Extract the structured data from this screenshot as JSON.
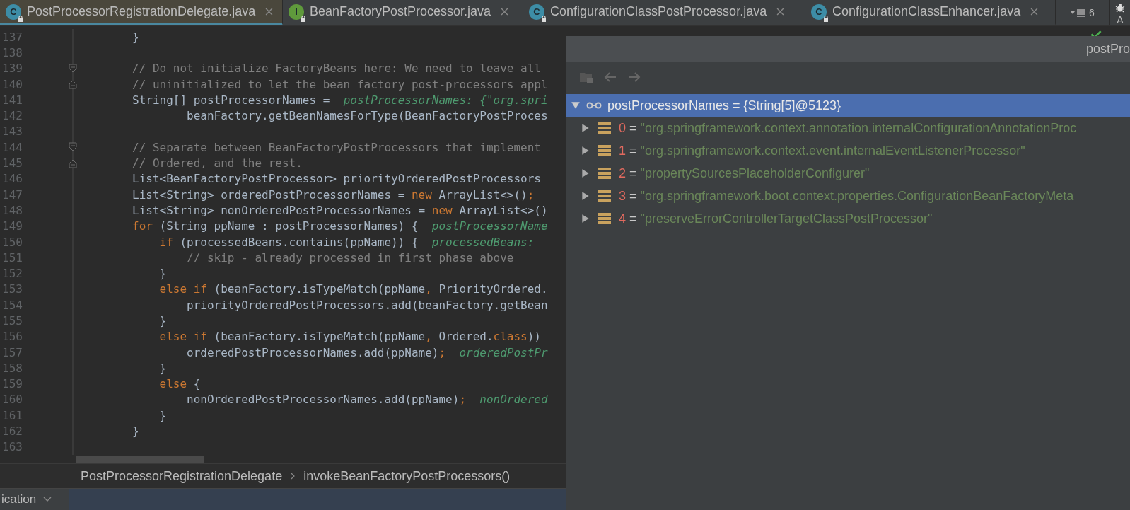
{
  "tabs": [
    {
      "label": "PostProcessorRegistrationDelegate.java",
      "kind": "class",
      "icon_letter": "C",
      "selected": true
    },
    {
      "label": "BeanFactoryPostProcessor.java",
      "kind": "interface",
      "icon_letter": "I",
      "selected": false
    },
    {
      "label": "ConfigurationClassPostProcessor.java",
      "kind": "class",
      "icon_letter": "C",
      "selected": false
    },
    {
      "label": "ConfigurationClassEnhancer.java",
      "kind": "class",
      "icon_letter": "C",
      "selected": false
    }
  ],
  "tab_overflow_count": "6",
  "side_strip_label": "A",
  "code_lines": [
    {
      "number": "137",
      "segments": [
        {
          "kind": "plain",
          "text": "}"
        }
      ]
    },
    {
      "number": "138"
    },
    {
      "number": "139",
      "kind": "fold_start",
      "segments": [
        {
          "kind": "comment",
          "text": "// Do not initialize FactoryBeans here: We need to leave all"
        }
      ]
    },
    {
      "number": "140",
      "kind": "fold_end",
      "segments": [
        {
          "kind": "comment",
          "text": "// uninitialized to let the bean factory post-processors appl"
        }
      ]
    },
    {
      "number": "141",
      "segments": [
        {
          "kind": "plain",
          "text": "String[] postProcessorNames =  "
        },
        {
          "kind": "hint",
          "text": "postProcessorNames: {\"org.spri"
        }
      ]
    },
    {
      "number": "142",
      "segments": [
        {
          "kind": "plain",
          "text": "        beanFactory.getBeanNamesForType(BeanFactoryPostProces"
        }
      ]
    },
    {
      "number": "143"
    },
    {
      "number": "144",
      "kind": "fold_start",
      "segments": [
        {
          "kind": "comment",
          "text": "// Separate between BeanFactoryPostProcessors that implement"
        }
      ]
    },
    {
      "number": "145",
      "kind": "fold_end",
      "segments": [
        {
          "kind": "comment",
          "text": "// Ordered, and the rest."
        }
      ]
    },
    {
      "number": "146",
      "segments": [
        {
          "kind": "plain",
          "text": "List<BeanFactoryPostProcessor> priorityOrderedPostProcessors"
        }
      ]
    },
    {
      "number": "147",
      "segments": [
        {
          "kind": "plain",
          "text": "List<String> orderedPostProcessorNames = "
        },
        {
          "kind": "keyword",
          "text": "new"
        },
        {
          "kind": "plain",
          "text": " ArrayList<>()"
        },
        {
          "kind": "keyword",
          "text": ";"
        }
      ]
    },
    {
      "number": "148",
      "segments": [
        {
          "kind": "plain",
          "text": "List<String> nonOrderedPostProcessorNames = "
        },
        {
          "kind": "keyword",
          "text": "new"
        },
        {
          "kind": "plain",
          "text": " ArrayList<>()"
        }
      ]
    },
    {
      "number": "149",
      "segments": [
        {
          "kind": "keyword",
          "text": "for"
        },
        {
          "kind": "plain",
          "text": " (String ppName : postProcessorNames) {  "
        },
        {
          "kind": "hint",
          "text": "postProcessorName"
        }
      ]
    },
    {
      "number": "150",
      "segments": [
        {
          "kind": "keyword",
          "text": "    if"
        },
        {
          "kind": "plain",
          "text": " (processedBeans.contains(ppName)) {  "
        },
        {
          "kind": "hint",
          "text": "processedBeans:"
        }
      ]
    },
    {
      "number": "151",
      "segments": [
        {
          "kind": "comment",
          "text": "        // skip - already processed in first phase above"
        }
      ]
    },
    {
      "number": "152",
      "segments": [
        {
          "kind": "plain",
          "text": "    }"
        }
      ]
    },
    {
      "number": "153",
      "segments": [
        {
          "kind": "keyword",
          "text": "    else if"
        },
        {
          "kind": "plain",
          "text": " (beanFactory.isTypeMatch(ppName"
        },
        {
          "kind": "keyword",
          "text": ","
        },
        {
          "kind": "plain",
          "text": " PriorityOrdered."
        }
      ]
    },
    {
      "number": "154",
      "segments": [
        {
          "kind": "plain",
          "text": "        priorityOrderedPostProcessors.add(beanFactory.getBean"
        }
      ]
    },
    {
      "number": "155",
      "segments": [
        {
          "kind": "plain",
          "text": "    }"
        }
      ]
    },
    {
      "number": "156",
      "segments": [
        {
          "kind": "keyword",
          "text": "    else if"
        },
        {
          "kind": "plain",
          "text": " (beanFactory.isTypeMatch(ppName"
        },
        {
          "kind": "keyword",
          "text": ","
        },
        {
          "kind": "plain",
          "text": " Ordered."
        },
        {
          "kind": "keyword",
          "text": "class"
        },
        {
          "kind": "plain",
          "text": "))"
        }
      ]
    },
    {
      "number": "157",
      "segments": [
        {
          "kind": "plain",
          "text": "        orderedPostProcessorNames.add(ppName)"
        },
        {
          "kind": "keyword",
          "text": ";"
        },
        {
          "kind": "hint",
          "text": "  orderedPostPr"
        }
      ]
    },
    {
      "number": "158",
      "segments": [
        {
          "kind": "plain",
          "text": "    }"
        }
      ]
    },
    {
      "number": "159",
      "segments": [
        {
          "kind": "keyword",
          "text": "    else"
        },
        {
          "kind": "plain",
          "text": " {"
        }
      ]
    },
    {
      "number": "160",
      "segments": [
        {
          "kind": "plain",
          "text": "        nonOrderedPostProcessorNames.add(ppName)"
        },
        {
          "kind": "keyword",
          "text": ";"
        },
        {
          "kind": "hint",
          "text": "  nonOrdered"
        }
      ]
    },
    {
      "number": "161",
      "segments": [
        {
          "kind": "plain",
          "text": "    }"
        }
      ]
    },
    {
      "number": "162",
      "segments": [
        {
          "kind": "plain",
          "text": "}"
        }
      ]
    },
    {
      "number": "163"
    }
  ],
  "breadcrumb": [
    "PostProcessorRegistrationDelegate",
    "invokeBeanFactoryPostProcessors()"
  ],
  "bottom_tab": "ication",
  "popup": {
    "title": "postPro",
    "root": {
      "label": "postProcessorNames = {String[5]@5123}",
      "expanded": true,
      "selected": true,
      "children": [
        {
          "index": "0",
          "separator": "=",
          "value": "\"org.springframework.context.annotation.internalConfigurationAnnotationProc",
          "expanded": false,
          "selected": false
        },
        {
          "index": "1",
          "separator": "=",
          "value": "\"org.springframework.context.event.internalEventListenerProcessor\"",
          "expanded": false,
          "selected": false
        },
        {
          "index": "2",
          "separator": "=",
          "value": "\"propertySourcesPlaceholderConfigurer\"",
          "expanded": false,
          "selected": false
        },
        {
          "index": "3",
          "separator": "=",
          "value": "\"org.springframework.boot.context.properties.ConfigurationBeanFactoryMeta",
          "expanded": false,
          "selected": false
        },
        {
          "index": "4",
          "separator": "=",
          "value": "\"preserveErrorControllerTargetClassPostProcessor\"",
          "expanded": false,
          "selected": false
        }
      ]
    }
  }
}
